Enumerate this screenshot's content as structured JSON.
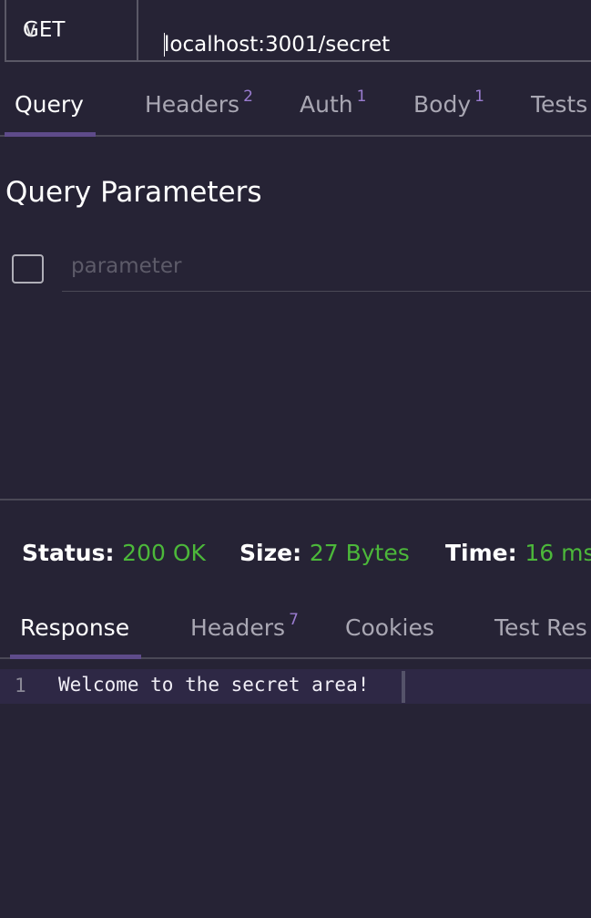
{
  "request": {
    "method": "GET",
    "url": "localhost:3001/secret"
  },
  "request_tabs": [
    {
      "label": "Query",
      "count": null
    },
    {
      "label": "Headers",
      "count": "2"
    },
    {
      "label": "Auth",
      "count": "1"
    },
    {
      "label": "Body",
      "count": "1"
    },
    {
      "label": "Tests",
      "count": null
    }
  ],
  "query": {
    "title": "Query Parameters",
    "param_placeholder": "parameter"
  },
  "status": {
    "status_label": "Status:",
    "status_value": "200 OK",
    "size_label": "Size:",
    "size_value": "27 Bytes",
    "time_label": "Time:",
    "time_value": "16 ms"
  },
  "response_tabs": [
    {
      "label": "Response"
    },
    {
      "label": "Headers",
      "count": "7"
    },
    {
      "label": "Cookies"
    },
    {
      "label": "Test Res"
    }
  ],
  "response": {
    "line_number": "1",
    "body": "Welcome to the secret area!"
  }
}
